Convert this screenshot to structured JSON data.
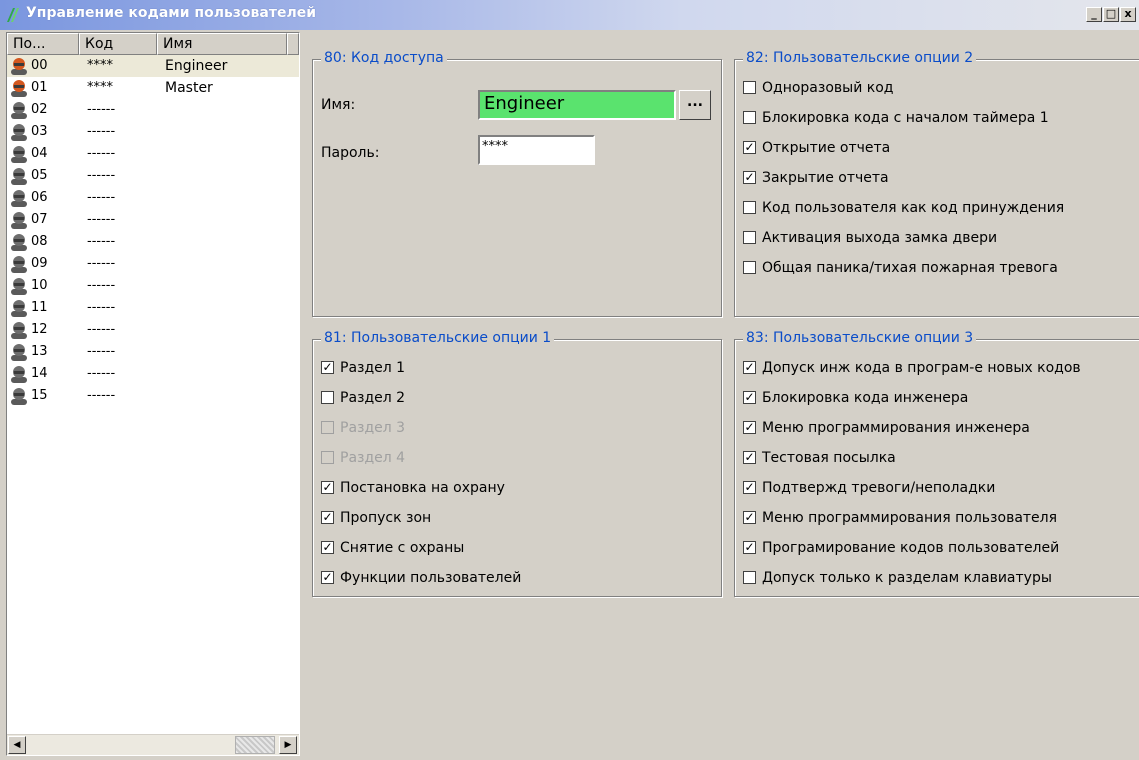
{
  "window": {
    "title": "Управление кодами пользователей",
    "minimize": "_",
    "maximize": "□",
    "close": "x"
  },
  "list": {
    "headers": [
      "По...",
      "Код",
      "Имя"
    ],
    "rows": [
      {
        "num": "00",
        "code": "****",
        "name": "Engineer",
        "icon": "user-active"
      },
      {
        "num": "01",
        "code": "****",
        "name": "Master",
        "icon": "user-active"
      },
      {
        "num": "02",
        "code": "------",
        "name": "",
        "icon": "user-inactive"
      },
      {
        "num": "03",
        "code": "------",
        "name": "",
        "icon": "user-inactive"
      },
      {
        "num": "04",
        "code": "------",
        "name": "",
        "icon": "user-inactive"
      },
      {
        "num": "05",
        "code": "------",
        "name": "",
        "icon": "user-inactive"
      },
      {
        "num": "06",
        "code": "------",
        "name": "",
        "icon": "user-inactive"
      },
      {
        "num": "07",
        "code": "------",
        "name": "",
        "icon": "user-inactive"
      },
      {
        "num": "08",
        "code": "------",
        "name": "",
        "icon": "user-inactive"
      },
      {
        "num": "09",
        "code": "------",
        "name": "",
        "icon": "user-inactive"
      },
      {
        "num": "10",
        "code": "------",
        "name": "",
        "icon": "user-inactive"
      },
      {
        "num": "11",
        "code": "------",
        "name": "",
        "icon": "user-inactive"
      },
      {
        "num": "12",
        "code": "------",
        "name": "",
        "icon": "user-inactive"
      },
      {
        "num": "13",
        "code": "------",
        "name": "",
        "icon": "user-inactive"
      },
      {
        "num": "14",
        "code": "------",
        "name": "",
        "icon": "user-inactive"
      },
      {
        "num": "15",
        "code": "------",
        "name": "",
        "icon": "user-inactive"
      }
    ],
    "scroll_left": "◀",
    "scroll_right": "▶"
  },
  "access": {
    "title": "80: Код доступа",
    "name_label": "Имя:",
    "name_value": "Engineer",
    "ellipsis": "...",
    "password_label": "Пароль:",
    "password_value": "****"
  },
  "opts1": {
    "title": "81: Пользовательские опции  1",
    "items": [
      {
        "label": "Раздел 1",
        "checked": true,
        "disabled": false
      },
      {
        "label": "Раздел 2",
        "checked": false,
        "disabled": false
      },
      {
        "label": "Раздел 3",
        "checked": false,
        "disabled": true
      },
      {
        "label": "Раздел 4",
        "checked": false,
        "disabled": true
      },
      {
        "label": "Постановка на охрану",
        "checked": true,
        "disabled": false
      },
      {
        "label": "Пропуск зон",
        "checked": true,
        "disabled": false
      },
      {
        "label": "Снятие с охраны",
        "checked": true,
        "disabled": false
      },
      {
        "label": "Функции пользователей",
        "checked": true,
        "disabled": false
      }
    ]
  },
  "opts2": {
    "title": "82: Пользовательские опции 2",
    "items": [
      {
        "label": "Одноразовый код",
        "checked": false,
        "disabled": false
      },
      {
        "label": "Блокировка кода с началом таймера 1",
        "checked": false,
        "disabled": false
      },
      {
        "label": "Открытие отчета",
        "checked": true,
        "disabled": false
      },
      {
        "label": "Закрытие отчета",
        "checked": true,
        "disabled": false
      },
      {
        "label": "Код пользователя  как код принуждения",
        "checked": false,
        "disabled": false
      },
      {
        "label": "Активация выхода замка двери",
        "checked": false,
        "disabled": false
      },
      {
        "label": "Общая паника/тихая пожарная тревога",
        "checked": false,
        "disabled": false
      }
    ]
  },
  "opts3": {
    "title": "83: Пользовательские опции 3",
    "items": [
      {
        "label": "Допуск инж кода в програм-е новых кодов",
        "checked": true,
        "disabled": false
      },
      {
        "label": "Блокировка кода инженера",
        "checked": true,
        "disabled": false
      },
      {
        "label": "Меню программирования инженера",
        "checked": true,
        "disabled": false
      },
      {
        "label": "Тестовая посылка",
        "checked": true,
        "disabled": false
      },
      {
        "label": "Подтвержд тревоги/неполадки",
        "checked": true,
        "disabled": false
      },
      {
        "label": "Меню программирования пользователя",
        "checked": true,
        "disabled": false
      },
      {
        "label": "Програмирование кодов пользователей",
        "checked": true,
        "disabled": false
      },
      {
        "label": "Допуск только к разделам клавиатуры",
        "checked": false,
        "disabled": false
      }
    ]
  },
  "colors": {
    "group_title": "#0a4cc9",
    "name_field_bg": "#5ae36e",
    "avatar_active": "#d4571e",
    "avatar_inactive": "#6e6e6e"
  }
}
